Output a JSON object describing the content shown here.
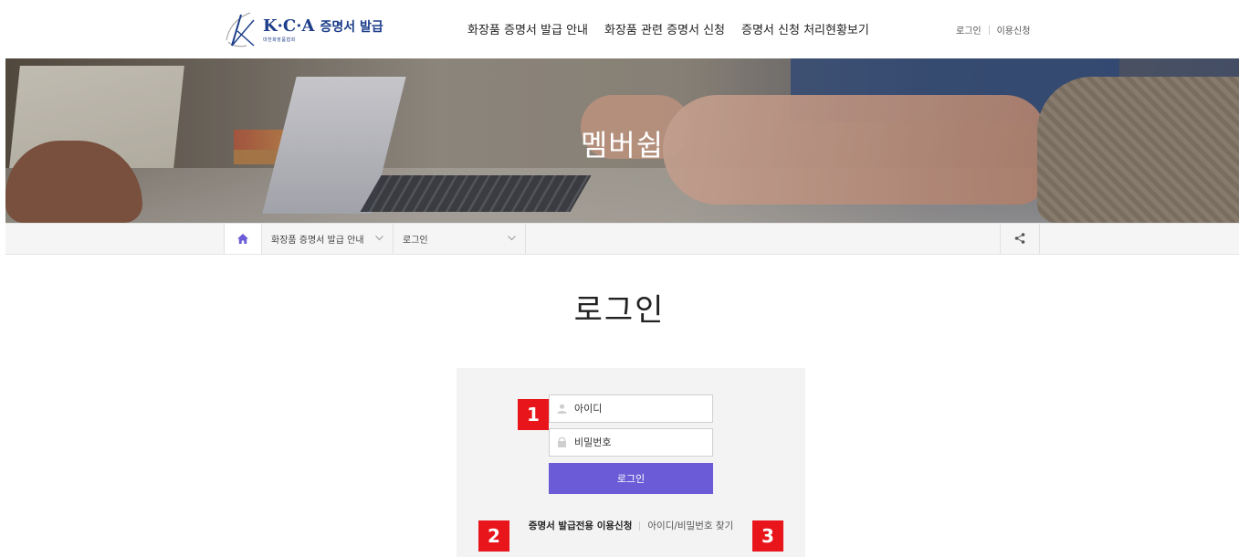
{
  "header": {
    "logo": {
      "mark": "K·C·A",
      "title": "증명서 발급",
      "subtitle": "대한화장품협회"
    },
    "gnb": [
      {
        "label": "화장품 증명서 발급 안내"
      },
      {
        "label": "화장품 관련 증명서 신청"
      },
      {
        "label": "증명서 신청 처리현황보기"
      }
    ],
    "util": {
      "login": "로그인",
      "signup": "이용신청"
    },
    "brand_color": "#1d3e8a"
  },
  "banner": {
    "title": "멤버쉽"
  },
  "location": {
    "home_icon": "home-icon",
    "depth1": "화장품 증명서 발급 안내",
    "depth2": "로그인",
    "share_icon": "share-icon",
    "accent_color": "#6b5bd6"
  },
  "main": {
    "title": "로그인",
    "form": {
      "id_placeholder": "아이디",
      "pw_placeholder": "비밀번호",
      "submit_label": "로그인",
      "button_color": "#6b5bd6"
    },
    "links": {
      "signup": "증명서 발급전용 이용신청",
      "find": "아이디/비밀번호 찾기"
    }
  },
  "annotations": {
    "badge1": "1",
    "badge2": "2",
    "badge3": "3",
    "color": "#e8151b"
  }
}
